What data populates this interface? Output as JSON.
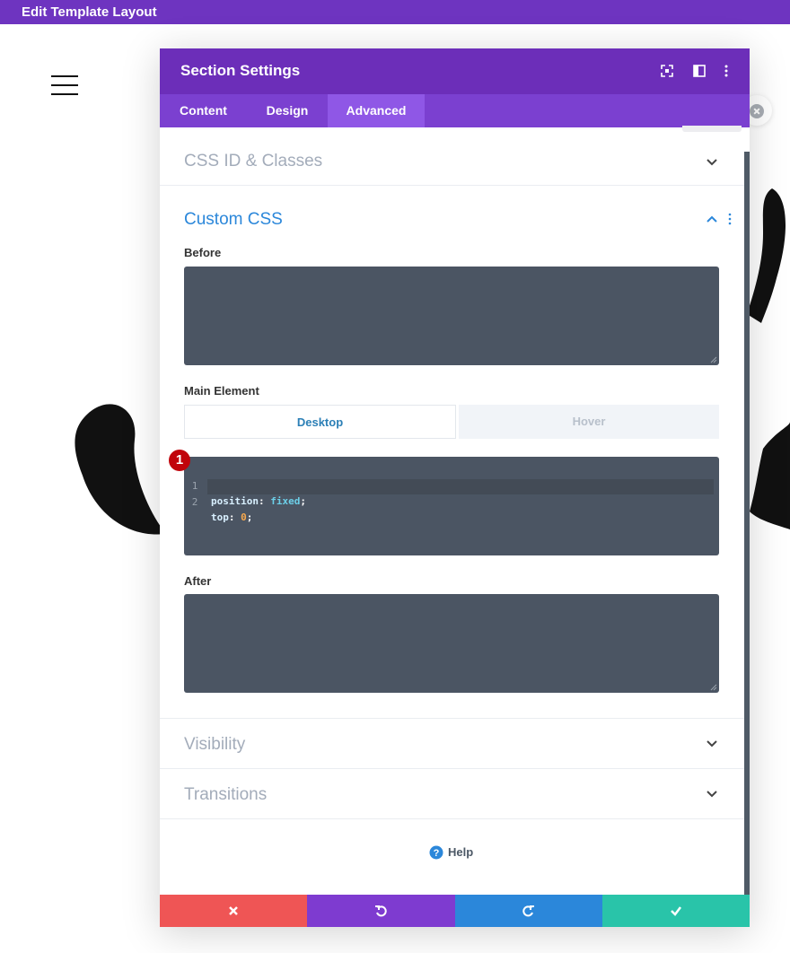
{
  "topbar": {
    "title": "Edit Template Layout"
  },
  "modal": {
    "title": "Section Settings",
    "header_icons": [
      "fullscreen-icon",
      "sidebar-layout-icon",
      "more-options-icon"
    ],
    "tabs": [
      {
        "label": "Content",
        "active": false
      },
      {
        "label": "Design",
        "active": false
      },
      {
        "label": "Advanced",
        "active": true
      }
    ],
    "sections": {
      "css_id": {
        "title": "CSS ID & Classes",
        "expanded": false
      },
      "custom_css": {
        "title": "Custom CSS",
        "expanded": true,
        "before_label": "Before",
        "main_label": "Main Element",
        "main_toggle": {
          "desktop": "Desktop",
          "hover": "Hover",
          "selected": "Desktop"
        },
        "code_lines": [
          {
            "num": "1",
            "prop": "position",
            "value": "fixed",
            "value_type": "keyword"
          },
          {
            "num": "2",
            "prop": "top",
            "value": "0",
            "value_type": "number"
          }
        ],
        "after_label": "After"
      },
      "visibility": {
        "title": "Visibility",
        "expanded": false
      },
      "transitions": {
        "title": "Transitions",
        "expanded": false
      }
    },
    "annotation_badge": "1",
    "help_label": "Help",
    "footer_buttons": [
      {
        "name": "discard",
        "icon": "close-icon",
        "color": "#ef5555"
      },
      {
        "name": "undo",
        "icon": "undo-icon",
        "color": "#7e3bd0"
      },
      {
        "name": "redo",
        "icon": "redo-icon",
        "color": "#2b87da"
      },
      {
        "name": "save",
        "icon": "check-icon",
        "color": "#29c4a9"
      }
    ]
  },
  "colors": {
    "topbar": "#6e34c0",
    "header": "#6c2eb9",
    "tabs": "#7b40d0",
    "active_tab": "#8f57e6",
    "section_active_title": "#2b87da",
    "section_inactive_title": "#a3acba",
    "code_bg": "#4b5563",
    "badge": "#c1040b"
  }
}
